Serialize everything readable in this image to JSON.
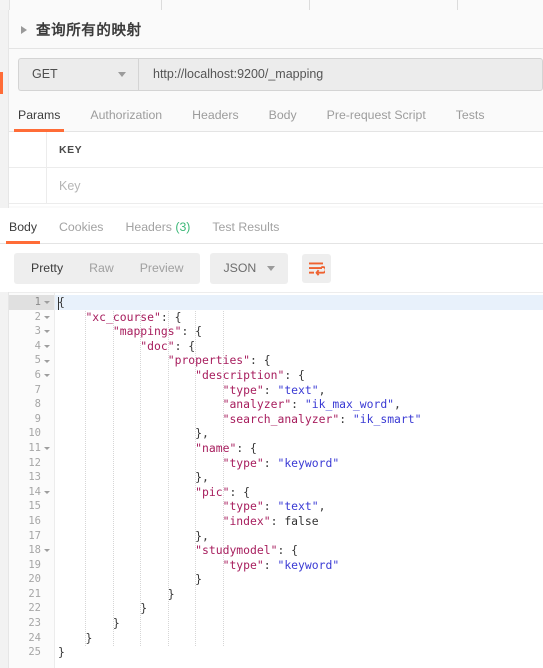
{
  "window": {
    "tabstrip_slots": 5
  },
  "request": {
    "title": "查询所有的映射",
    "collapse_icon": "triangle-right-icon",
    "method": "GET",
    "method_caret_icon": "chevron-down-icon",
    "url": "http://localhost:9200/_mapping",
    "accent_color": "#ff6c37"
  },
  "request_tabs": [
    {
      "label": "Params",
      "active": true
    },
    {
      "label": "Authorization",
      "active": false
    },
    {
      "label": "Headers",
      "active": false
    },
    {
      "label": "Body",
      "active": false
    },
    {
      "label": "Pre-request Script",
      "active": false
    },
    {
      "label": "Tests",
      "active": false
    }
  ],
  "params_table": {
    "header": {
      "key": "KEY"
    },
    "rows": [
      {
        "key_placeholder": "Key"
      }
    ]
  },
  "response_tabs": [
    {
      "label": "Body",
      "count": "",
      "active": true
    },
    {
      "label": "Cookies",
      "count": "",
      "active": false
    },
    {
      "label": "Headers",
      "count": "(3)",
      "active": false
    },
    {
      "label": "Test Results",
      "count": "",
      "active": false
    }
  ],
  "viewer_toolbar": {
    "modes": [
      {
        "label": "Pretty",
        "active": true
      },
      {
        "label": "Raw",
        "active": false
      },
      {
        "label": "Preview",
        "active": false
      }
    ],
    "format": "JSON",
    "format_caret_icon": "chevron-down-icon",
    "wrap_icon": "word-wrap-icon",
    "wrap_icon_color": "#ef6230"
  },
  "code": {
    "active_line": 1,
    "lines": [
      {
        "n": 1,
        "fold": true,
        "indent": 0,
        "tokens": [
          {
            "t": "{",
            "c": "p"
          }
        ]
      },
      {
        "n": 2,
        "fold": true,
        "indent": 1,
        "tokens": [
          {
            "t": "\"xc_course\"",
            "c": "k"
          },
          {
            "t": ": {",
            "c": "p"
          }
        ]
      },
      {
        "n": 3,
        "fold": true,
        "indent": 2,
        "tokens": [
          {
            "t": "\"mappings\"",
            "c": "k"
          },
          {
            "t": ": {",
            "c": "p"
          }
        ]
      },
      {
        "n": 4,
        "fold": true,
        "indent": 3,
        "tokens": [
          {
            "t": "\"doc\"",
            "c": "k"
          },
          {
            "t": ": {",
            "c": "p"
          }
        ]
      },
      {
        "n": 5,
        "fold": true,
        "indent": 4,
        "tokens": [
          {
            "t": "\"properties\"",
            "c": "k"
          },
          {
            "t": ": {",
            "c": "p"
          }
        ]
      },
      {
        "n": 6,
        "fold": true,
        "indent": 5,
        "tokens": [
          {
            "t": "\"description\"",
            "c": "k"
          },
          {
            "t": ": {",
            "c": "p"
          }
        ]
      },
      {
        "n": 7,
        "fold": false,
        "indent": 6,
        "tokens": [
          {
            "t": "\"type\"",
            "c": "k"
          },
          {
            "t": ": ",
            "c": "p"
          },
          {
            "t": "\"text\"",
            "c": "s"
          },
          {
            "t": ",",
            "c": "p"
          }
        ]
      },
      {
        "n": 8,
        "fold": false,
        "indent": 6,
        "tokens": [
          {
            "t": "\"analyzer\"",
            "c": "k"
          },
          {
            "t": ": ",
            "c": "p"
          },
          {
            "t": "\"ik_max_word\"",
            "c": "s"
          },
          {
            "t": ",",
            "c": "p"
          }
        ]
      },
      {
        "n": 9,
        "fold": false,
        "indent": 6,
        "tokens": [
          {
            "t": "\"search_analyzer\"",
            "c": "k"
          },
          {
            "t": ": ",
            "c": "p"
          },
          {
            "t": "\"ik_smart\"",
            "c": "s"
          }
        ]
      },
      {
        "n": 10,
        "fold": false,
        "indent": 5,
        "tokens": [
          {
            "t": "},",
            "c": "p"
          }
        ]
      },
      {
        "n": 11,
        "fold": true,
        "indent": 5,
        "tokens": [
          {
            "t": "\"name\"",
            "c": "k"
          },
          {
            "t": ": {",
            "c": "p"
          }
        ]
      },
      {
        "n": 12,
        "fold": false,
        "indent": 6,
        "tokens": [
          {
            "t": "\"type\"",
            "c": "k"
          },
          {
            "t": ": ",
            "c": "p"
          },
          {
            "t": "\"keyword\"",
            "c": "s"
          }
        ]
      },
      {
        "n": 13,
        "fold": false,
        "indent": 5,
        "tokens": [
          {
            "t": "},",
            "c": "p"
          }
        ]
      },
      {
        "n": 14,
        "fold": true,
        "indent": 5,
        "tokens": [
          {
            "t": "\"pic\"",
            "c": "k"
          },
          {
            "t": ": {",
            "c": "p"
          }
        ]
      },
      {
        "n": 15,
        "fold": false,
        "indent": 6,
        "tokens": [
          {
            "t": "\"type\"",
            "c": "k"
          },
          {
            "t": ": ",
            "c": "p"
          },
          {
            "t": "\"text\"",
            "c": "s"
          },
          {
            "t": ",",
            "c": "p"
          }
        ]
      },
      {
        "n": 16,
        "fold": false,
        "indent": 6,
        "tokens": [
          {
            "t": "\"index\"",
            "c": "k"
          },
          {
            "t": ": ",
            "c": "p"
          },
          {
            "t": "false",
            "c": "b"
          }
        ]
      },
      {
        "n": 17,
        "fold": false,
        "indent": 5,
        "tokens": [
          {
            "t": "},",
            "c": "p"
          }
        ]
      },
      {
        "n": 18,
        "fold": true,
        "indent": 5,
        "tokens": [
          {
            "t": "\"studymodel\"",
            "c": "k"
          },
          {
            "t": ": {",
            "c": "p"
          }
        ]
      },
      {
        "n": 19,
        "fold": false,
        "indent": 6,
        "tokens": [
          {
            "t": "\"type\"",
            "c": "k"
          },
          {
            "t": ": ",
            "c": "p"
          },
          {
            "t": "\"keyword\"",
            "c": "s"
          }
        ]
      },
      {
        "n": 20,
        "fold": false,
        "indent": 5,
        "tokens": [
          {
            "t": "}",
            "c": "p"
          }
        ]
      },
      {
        "n": 21,
        "fold": false,
        "indent": 4,
        "tokens": [
          {
            "t": "}",
            "c": "p"
          }
        ]
      },
      {
        "n": 22,
        "fold": false,
        "indent": 3,
        "tokens": [
          {
            "t": "}",
            "c": "p"
          }
        ]
      },
      {
        "n": 23,
        "fold": false,
        "indent": 2,
        "tokens": [
          {
            "t": "}",
            "c": "p"
          }
        ]
      },
      {
        "n": 24,
        "fold": false,
        "indent": 1,
        "tokens": [
          {
            "t": "}",
            "c": "p"
          }
        ]
      },
      {
        "n": 25,
        "fold": false,
        "indent": 0,
        "tokens": [
          {
            "t": "}",
            "c": "p"
          }
        ]
      }
    ]
  }
}
